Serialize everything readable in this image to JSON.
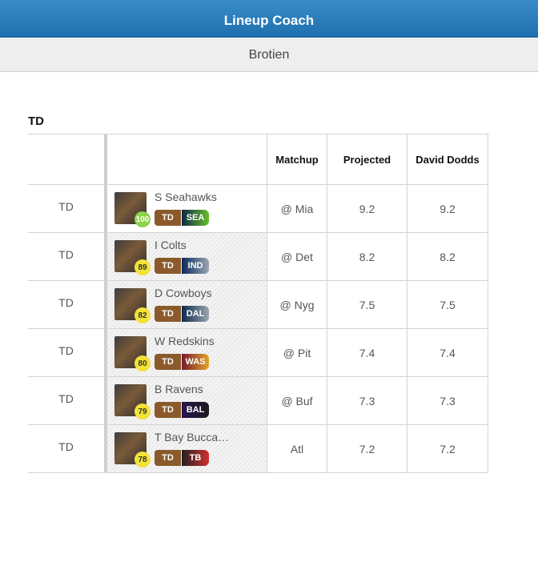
{
  "app": {
    "title": "Lineup Coach"
  },
  "team": {
    "name": "Brotien"
  },
  "section": {
    "title": "TD"
  },
  "table": {
    "headers": {
      "matchup": "Matchup",
      "projected": "Projected",
      "expert": "David Dodds"
    },
    "rows": [
      {
        "pos": "TD",
        "name": "S Seahawks",
        "score": "100",
        "score_color": "#8cd24a",
        "tag": "TD",
        "team": "SEA",
        "team_colors": [
          "#0b2a4a",
          "#69be28"
        ],
        "matchup": "@ Mia",
        "projected": "9.2",
        "expert": "9.2"
      },
      {
        "pos": "TD",
        "name": "I Colts",
        "score": "89",
        "score_color": "#f2e23a",
        "tag": "TD",
        "team": "IND",
        "team_colors": [
          "#0a2a5c",
          "#9aa6b2"
        ],
        "matchup": "@ Det",
        "projected": "8.2",
        "expert": "8.2"
      },
      {
        "pos": "TD",
        "name": "D Cowboys",
        "score": "82",
        "score_color": "#f2e23a",
        "tag": "TD",
        "team": "DAL",
        "team_colors": [
          "#0b2a4a",
          "#9aa6b2"
        ],
        "matchup": "@ Nyg",
        "projected": "7.5",
        "expert": "7.5"
      },
      {
        "pos": "TD",
        "name": "W Redskins",
        "score": "80",
        "score_color": "#f2e23a",
        "tag": "TD",
        "team": "WAS",
        "team_colors": [
          "#7a1a2e",
          "#e0a52a"
        ],
        "matchup": "@ Pit",
        "projected": "7.4",
        "expert": "7.4"
      },
      {
        "pos": "TD",
        "name": "B Ravens",
        "score": "79",
        "score_color": "#f2e23a",
        "tag": "TD",
        "team": "BAL",
        "team_colors": [
          "#2a1450",
          "#1a1a1a"
        ],
        "matchup": "@ Buf",
        "projected": "7.3",
        "expert": "7.3"
      },
      {
        "pos": "TD",
        "name": "T Bay Bucca…",
        "score": "78",
        "score_color": "#f2e23a",
        "tag": "TD",
        "team": "TB",
        "team_colors": [
          "#222222",
          "#d32f2f"
        ],
        "matchup": "Atl",
        "projected": "7.2",
        "expert": "7.2"
      }
    ]
  }
}
